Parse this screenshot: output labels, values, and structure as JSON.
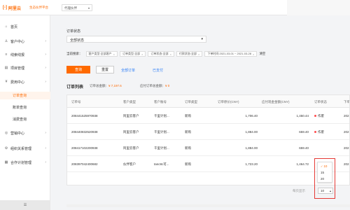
{
  "topbar": {
    "logo_mark": "[-]",
    "logo_text": "阿里云",
    "platform": "生态伙伴平台",
    "org_select": "代理伙伴"
  },
  "sidebar": {
    "items": [
      {
        "icon": "home-icon",
        "glyph": "⌂",
        "label": "首页"
      },
      {
        "icon": "customer-icon",
        "glyph": "♙",
        "label": "客户中心",
        "chevron": "›"
      },
      {
        "icon": "lead-icon",
        "glyph": "≡",
        "label": "线索线报",
        "chevron": "›"
      },
      {
        "icon": "project-icon",
        "glyph": "▤",
        "label": "项目管理",
        "chevron": "›"
      },
      {
        "icon": "fee-icon",
        "glyph": "¥",
        "label": "费用中心",
        "chevron": "›"
      }
    ],
    "sub_items": [
      {
        "label": "订单查询",
        "active": true
      },
      {
        "label": "账单查询",
        "active": false
      },
      {
        "label": "消费查询",
        "active": false
      }
    ],
    "items2": [
      {
        "icon": "marketing-icon",
        "glyph": "◎",
        "label": "营销中心",
        "chevron": "›"
      },
      {
        "icon": "org-icon",
        "glyph": "⚙",
        "label": "组织关系管理",
        "chevron": "›"
      },
      {
        "icon": "contract-icon",
        "glyph": "▦",
        "label": "合作计划管理",
        "chevron": "›"
      }
    ],
    "collapse_label": "☰"
  },
  "filter": {
    "label": "订单状态",
    "status_value": "全部状态",
    "conditions_title": "当前搜索：",
    "chips": [
      "客户类型:全部客户",
      "订单类型:全部",
      "订单状态:全部",
      "付款状态:全部",
      "下单时间:2021-03-01 ~ 2021-03-28"
    ],
    "clear_label": "清空",
    "query_button": "查询",
    "reset_button": "重置",
    "link_a": "全部订单",
    "link_b": "已支付"
  },
  "list": {
    "title": "订单列表",
    "stat1_label": "订单总金额：",
    "stat1_value": "¥ 7,197.6",
    "stat2_label": "应付订单总金额：",
    "stat2_value": "¥ 0"
  },
  "table": {
    "headers": [
      "订单号",
      "客户类型",
      "客户账号",
      "订单类型",
      "订单原价(CNY)",
      "应付现金金额(CNY)",
      "订单状态",
      "下单"
    ],
    "rows": [
      [
        "208441525970938",
        "阿里云客户",
        "千里计划...",
        "新购",
        "1,706.40",
        "1,450.44",
        "作废",
        "202"
      ],
      [
        "208440832520938",
        "阿里云客户",
        "千里计划...",
        "新购",
        "1,884.00",
        "659.40",
        "作废",
        "202"
      ],
      [
        "208417102200938",
        "阿里云客户",
        "千里计划...",
        "新购",
        "1,884.00",
        "659.40",
        "作废",
        "202"
      ],
      [
        "208397042400682",
        "伙伴客户",
        "tanc8c可...",
        "新购",
        "1,723.20",
        "1,464.72",
        "作废",
        "202"
      ]
    ]
  },
  "pager": {
    "hint": "每页显示",
    "options": [
      "10",
      "15",
      "20"
    ],
    "selected": "10"
  }
}
